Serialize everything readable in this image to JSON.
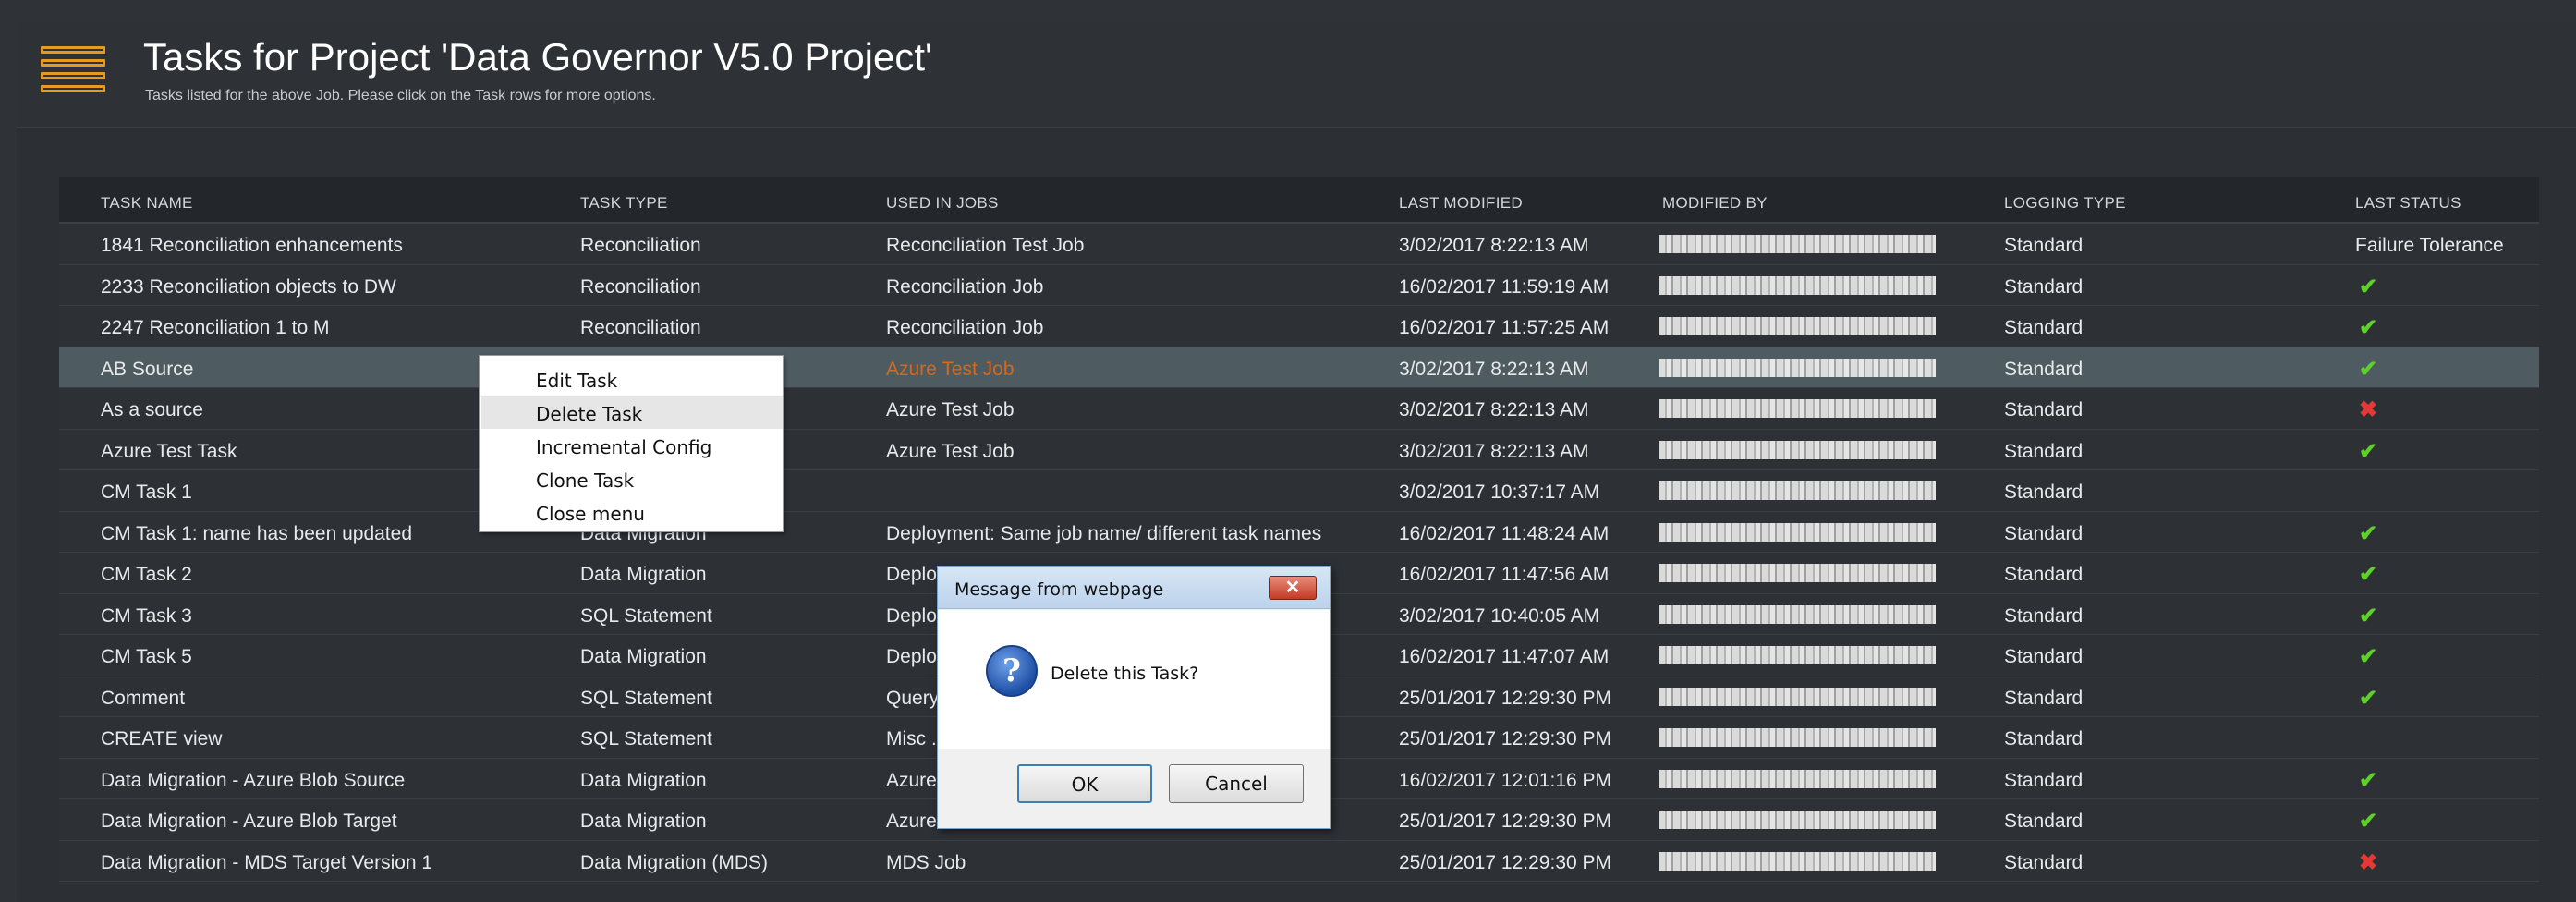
{
  "header": {
    "title": "Tasks for Project 'Data Governor V5.0 Project'",
    "subtitle": "Tasks listed for the above Job. Please click on the Task rows for more options."
  },
  "table": {
    "columns": [
      "TASK NAME",
      "TASK TYPE",
      "USED IN JOBS",
      "LAST MODIFIED",
      "MODIFIED BY",
      "LOGGING TYPE",
      "LAST STATUS"
    ],
    "rows": [
      {
        "name": "1841 Reconciliation enhancements",
        "type": "Reconciliation",
        "jobs": "Reconciliation Test Job",
        "modified": "3/02/2017 8:22:13 AM",
        "logging": "Standard",
        "status_text": "Failure Tolerance",
        "status": "text"
      },
      {
        "name": "2233 Reconciliation objects to DW",
        "type": "Reconciliation",
        "jobs": "Reconciliation Job",
        "modified": "16/02/2017 11:59:19 AM",
        "logging": "Standard",
        "status": "check-icon"
      },
      {
        "name": "2247 Reconciliation 1 to M",
        "type": "Reconciliation",
        "jobs": "Reconciliation Job",
        "modified": "16/02/2017 11:57:25 AM",
        "logging": "Standard",
        "status": "check-icon"
      },
      {
        "name": "AB Source",
        "type": "",
        "jobs": "Azure Test Job",
        "modified": "3/02/2017 8:22:13 AM",
        "logging": "Standard",
        "status": "check-icon",
        "selected": true
      },
      {
        "name": "As a source",
        "type": "",
        "jobs": "Azure Test Job",
        "modified": "3/02/2017 8:22:13 AM",
        "logging": "Standard",
        "status": "cross-icon"
      },
      {
        "name": "Azure Test Task",
        "type": "",
        "jobs": "Azure Test Job",
        "modified": "3/02/2017 8:22:13 AM",
        "logging": "Standard",
        "status": "check-icon"
      },
      {
        "name": "CM Task 1",
        "type": "",
        "jobs": "",
        "modified": "3/02/2017 10:37:17 AM",
        "logging": "Standard",
        "status": "none"
      },
      {
        "name": "CM Task 1: name has been updated",
        "type": "Data Migration",
        "jobs": "Deployment: Same job name/ different task names",
        "modified": "16/02/2017 11:48:24 AM",
        "logging": "Standard",
        "status": "check-icon"
      },
      {
        "name": "CM Task 2",
        "type": "Data Migration",
        "jobs": "Deplo",
        "modified": "16/02/2017 11:47:56 AM",
        "logging": "Standard",
        "status": "check-icon"
      },
      {
        "name": "CM Task 3",
        "type": "SQL Statement",
        "jobs": "Deplo",
        "modified": "3/02/2017 10:40:05 AM",
        "logging": "Standard",
        "status": "check-icon"
      },
      {
        "name": "CM Task 5",
        "type": "Data Migration",
        "jobs": "Deplo",
        "modified": "16/02/2017 11:47:07 AM",
        "logging": "Standard",
        "status": "check-icon"
      },
      {
        "name": "Comment",
        "type": "SQL Statement",
        "jobs": "Query",
        "modified": "25/01/2017 12:29:30 PM",
        "logging": "Standard",
        "status": "check-icon"
      },
      {
        "name": "CREATE view",
        "type": "SQL Statement",
        "jobs": "Misc .",
        "modified": "25/01/2017 12:29:30 PM",
        "logging": "Standard",
        "status": "none"
      },
      {
        "name": "Data Migration - Azure Blob Source",
        "type": "Data Migration",
        "jobs": "Azure",
        "modified": "16/02/2017 12:01:16 PM",
        "logging": "Standard",
        "status": "check-icon"
      },
      {
        "name": "Data Migration - Azure Blob Target",
        "type": "Data Migration",
        "jobs": "Azure",
        "modified": "25/01/2017 12:29:30 PM",
        "logging": "Standard",
        "status": "check-icon"
      },
      {
        "name": "Data Migration - MDS Target Version 1",
        "type": "Data Migration (MDS)",
        "jobs": "MDS Job",
        "modified": "25/01/2017 12:29:30 PM",
        "logging": "Standard",
        "status": "cross-icon"
      }
    ]
  },
  "context_menu": {
    "items": [
      "Edit Task",
      "Delete Task",
      "Incremental Config",
      "Clone Task",
      "Close menu"
    ],
    "hovered_index": 1
  },
  "dialog": {
    "title": "Message from webpage",
    "message": "Delete this Task?",
    "ok_label": "OK",
    "cancel_label": "Cancel",
    "close_glyph": "✕"
  },
  "colors": {
    "accent": "#e69b1e",
    "ok": "#5fcf2a",
    "error": "#e53935",
    "selected_row": "#4e5c62",
    "selected_job_text": "#d2691e"
  }
}
